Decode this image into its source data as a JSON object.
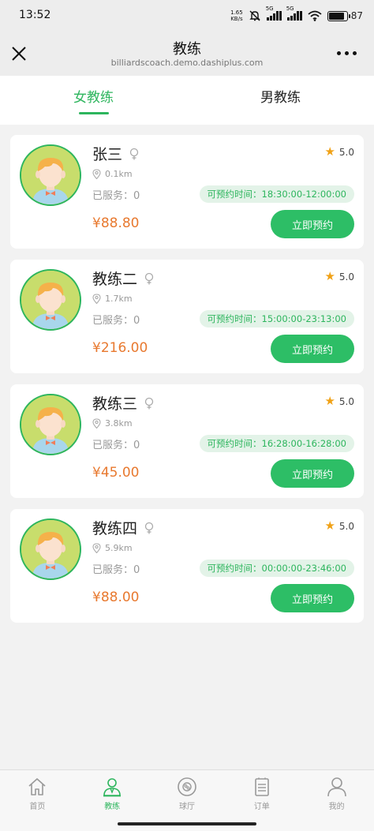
{
  "status_bar": {
    "time": "13:52",
    "net_speed_value": "1.65",
    "net_speed_unit": "KB/s",
    "network_1": "5G",
    "network_2": "5G",
    "battery": "87"
  },
  "header": {
    "title": "教练",
    "subtitle": "billiardscoach.demo.dashiplus.com",
    "close_icon": "close-icon",
    "more_icon": "more-icon"
  },
  "tabs": [
    {
      "label": "女教练",
      "active": true
    },
    {
      "label": "男教练",
      "active": false
    }
  ],
  "coaches": [
    {
      "name": "张三",
      "distance": "0.1km",
      "served": "已服务：0",
      "availability": "可预约时间：18:30:00-12:00:00",
      "price": "¥88.80",
      "rating": "5.0",
      "book_label": "立即预约"
    },
    {
      "name": "教练二",
      "distance": "1.7km",
      "served": "已服务：0",
      "availability": "可预约时间：15:00:00-23:13:00",
      "price": "¥216.00",
      "rating": "5.0",
      "book_label": "立即预约"
    },
    {
      "name": "教练三",
      "distance": "3.8km",
      "served": "已服务：0",
      "availability": "可预约时间：16:28:00-16:28:00",
      "price": "¥45.00",
      "rating": "5.0",
      "book_label": "立即预约"
    },
    {
      "name": "教练四",
      "distance": "5.9km",
      "served": "已服务：0",
      "availability": "可预约时间：00:00:00-23:46:00",
      "price": "¥88.00",
      "rating": "5.0",
      "book_label": "立即预约"
    }
  ],
  "bottom_nav": [
    {
      "label": "首页",
      "icon": "home-icon",
      "active": false
    },
    {
      "label": "教练",
      "icon": "coach-icon",
      "active": true
    },
    {
      "label": "球厅",
      "icon": "billiard-hall-icon",
      "active": false
    },
    {
      "label": "订单",
      "icon": "order-icon",
      "active": false
    },
    {
      "label": "我的",
      "icon": "profile-icon",
      "active": false
    }
  ],
  "colors": {
    "accent": "#2db55d",
    "price": "#e8792f",
    "star": "#f0a116"
  }
}
